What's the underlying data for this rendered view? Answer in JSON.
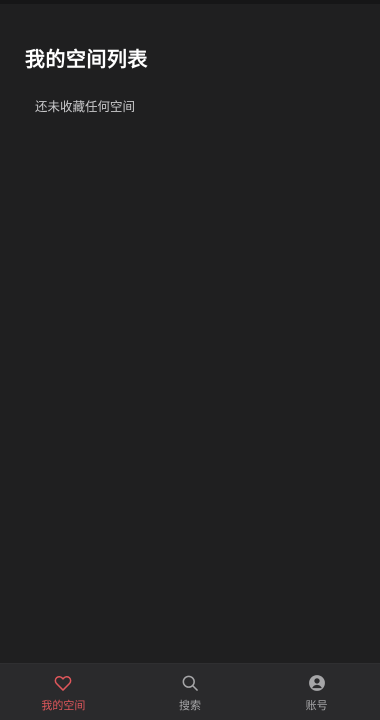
{
  "header": {
    "title": "我的空间列表"
  },
  "main": {
    "empty_message": "还未收藏任何空间"
  },
  "tabbar": {
    "tabs": [
      {
        "label": "我的空间",
        "icon": "heart-icon",
        "active": true
      },
      {
        "label": "搜索",
        "icon": "search-icon",
        "active": false
      },
      {
        "label": "账号",
        "icon": "account-icon",
        "active": false
      }
    ]
  },
  "colors": {
    "background": "#1f1f20",
    "tabbar": "#2a2a2c",
    "accent": "#e0575b",
    "inactive": "#a6a6a8"
  }
}
